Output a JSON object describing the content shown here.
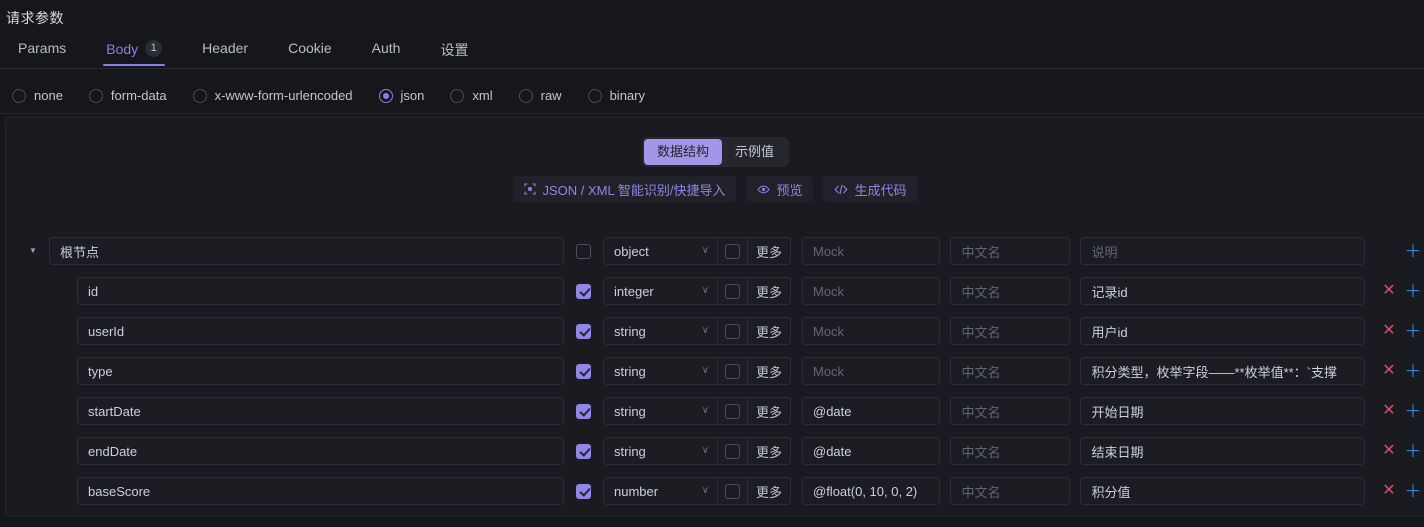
{
  "page_title": "请求参数",
  "tabs": [
    {
      "label": "Params",
      "badge": "",
      "active": false
    },
    {
      "label": "Body",
      "badge": "1",
      "active": true
    },
    {
      "label": "Header",
      "badge": "",
      "active": false
    },
    {
      "label": "Cookie",
      "badge": "",
      "active": false
    },
    {
      "label": "Auth",
      "badge": "",
      "active": false
    },
    {
      "label": "设置",
      "badge": "",
      "active": false
    }
  ],
  "body_types": [
    {
      "label": "none",
      "checked": false
    },
    {
      "label": "form-data",
      "checked": false
    },
    {
      "label": "x-www-form-urlencoded",
      "checked": false
    },
    {
      "label": "json",
      "checked": true
    },
    {
      "label": "xml",
      "checked": false
    },
    {
      "label": "raw",
      "checked": false
    },
    {
      "label": "binary",
      "checked": false
    }
  ],
  "segmented": [
    {
      "label": "数据结构",
      "active": true
    },
    {
      "label": "示例值",
      "active": false
    }
  ],
  "actions": [
    {
      "label": "JSON / XML 智能识别/快捷导入",
      "icon": "scan-icon"
    },
    {
      "label": "预览",
      "icon": "eye-icon"
    },
    {
      "label": "生成代码",
      "icon": "code-icon"
    }
  ],
  "placeholders": {
    "mock": "Mock",
    "cn_name": "中文名",
    "description": "说明"
  },
  "more_label": "更多",
  "rows": [
    {
      "kind": "root",
      "name": "根节点",
      "required": false,
      "type": "object",
      "type_flag": false,
      "mock": "",
      "cn_name": "",
      "description": "",
      "deletable": false
    },
    {
      "kind": "child",
      "name": "id",
      "required": true,
      "type": "integer",
      "type_flag": false,
      "mock": "",
      "cn_name": "",
      "description": "记录id",
      "deletable": true
    },
    {
      "kind": "child",
      "name": "userId",
      "required": true,
      "type": "string",
      "type_flag": false,
      "mock": "",
      "cn_name": "",
      "description": "用户id",
      "deletable": true
    },
    {
      "kind": "child",
      "name": "type",
      "required": true,
      "type": "string",
      "type_flag": false,
      "mock": "",
      "cn_name": "",
      "description": "积分类型，枚举字段——**枚举值**：`支撑",
      "deletable": true
    },
    {
      "kind": "child",
      "name": "startDate",
      "required": true,
      "type": "string",
      "type_flag": false,
      "mock": "@date",
      "cn_name": "",
      "description": "开始日期",
      "deletable": true
    },
    {
      "kind": "child",
      "name": "endDate",
      "required": true,
      "type": "string",
      "type_flag": false,
      "mock": "@date",
      "cn_name": "",
      "description": "结束日期",
      "deletable": true
    },
    {
      "kind": "child",
      "name": "baseScore",
      "required": true,
      "type": "number",
      "type_flag": false,
      "mock": "@float(0, 10, 0, 2)",
      "cn_name": "",
      "description": "积分值",
      "deletable": true
    }
  ],
  "colors": {
    "accent": "#8a7fe8",
    "checkbox": "#9286e6",
    "delete": "#d44f6e",
    "add": "#3b7fd4",
    "background": "#16171b",
    "panel": "#1a1b20"
  }
}
